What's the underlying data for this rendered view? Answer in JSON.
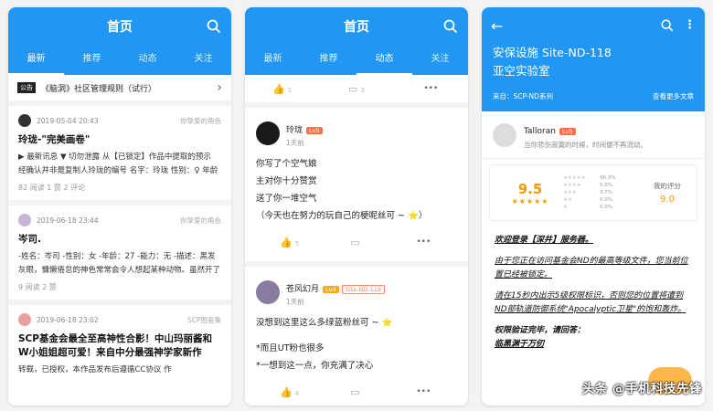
{
  "colors": {
    "primary": "#2196f3",
    "accent": "#ff9800"
  },
  "phone1": {
    "app_title": "首页",
    "tabs": [
      "最新",
      "推荐",
      "动态",
      "关注"
    ],
    "notice": {
      "tag": "公告",
      "text": "《脑洞》社区管理规则（试行）"
    },
    "posts": [
      {
        "date": "2019-05-04 20:43",
        "category": "你挚爱的角色",
        "title": "玲珑-\"完美画卷\"",
        "excerpt": "▶ 最新讯息 ▼ 切勿泄露 从【已锁定】作品中提取的预示 经确认并非是复制人玲珑的编号 名字：玲珑 性别：♀ 年龄 创作时间：四月一号不明 最高权限：...",
        "stats": "82 阅读 1 赞 2 评论"
      },
      {
        "date": "2019-06-18 23:44",
        "category": "你挚爱的角色",
        "title": "岑司.",
        "excerpt": "-姓名：岑司 -性别：女 -年龄：27 -能力：无 -描述：黑发灰眼，慵懒倦怠的神色常常会令人想起某种动物。虽然开了家不错的会员酒吧，但并不算太在意...",
        "stats": "9 阅读 2 赞"
      },
      {
        "date": "2019-06-18 23:02",
        "category": "SCP图鉴集",
        "title": "SCP基金会最全至高神性合影！中山玛丽酱和W小姐姐超可爱！来自中分最强神学家新作",
        "excerpt": "转载，已授权，本作品发布后遵循CC协议 作",
        "stats": ""
      }
    ]
  },
  "phone2": {
    "app_title": "首页",
    "tabs": [
      "最新",
      "推荐",
      "动态",
      "关注"
    ],
    "top_actions": {
      "likes": "1",
      "comments": "3",
      "more": "•••"
    },
    "feeds": [
      {
        "name": "玲珑",
        "level": "Lv5",
        "site_id": "",
        "time": "1天前",
        "lines": [
          "你写了个空气娘",
          "主对你十分赞赏",
          "送了你一堆空气",
          "（今天也在努力的玩自己的梗呢丝可 ~ ⭐）"
        ],
        "likes": "5",
        "comments": "",
        "more": "•••"
      },
      {
        "name": "苍风幻月",
        "level": "Lv4",
        "site_id": "Site-ND-118",
        "time": "1天前",
        "lines": [
          "没想到这里这么多绿蓝粉丝可 ~ ⭐",
          "",
          "*而且UT粉也很多",
          "*一想到这一点，你充满了决心"
        ],
        "likes": "4",
        "comments": "",
        "more": "•••"
      }
    ]
  },
  "phone3": {
    "title_line1": "安保设施  Site-ND-118",
    "title_line2": "亚空实验室",
    "source": "来自：SCP-ND系列",
    "more_articles": "查看更多文章",
    "author": {
      "name": "Talloran",
      "level": "Lv5",
      "signature": "当你悲伤寂寞的时候，时间便不再流动。"
    },
    "rating": {
      "score": "9.5",
      "stars": "★★★★★",
      "distribution": [
        "96.3%",
        "0.0%",
        "3.7%",
        "0.0%",
        "0.0%"
      ],
      "distribution_values": [
        96.3,
        0.0,
        3.7,
        0.0,
        0.0
      ],
      "my_label": "我的评分",
      "my_score": "9.0"
    },
    "body": [
      "欢迎登录【深井】服务器。",
      "由于您正在访问基金会ND的最高等级文件，您当前位置已经被锁定。",
      "请在15秒内出示5级权限标识，否则您的位置将遭到ND部轨道防御系统\"Apocalyptic卫星\"的饱和轰炸。",
      "权限验证完毕，请回答：",
      "临黑渊于万仞"
    ]
  },
  "watermark": "头条 @手机科技先锋"
}
